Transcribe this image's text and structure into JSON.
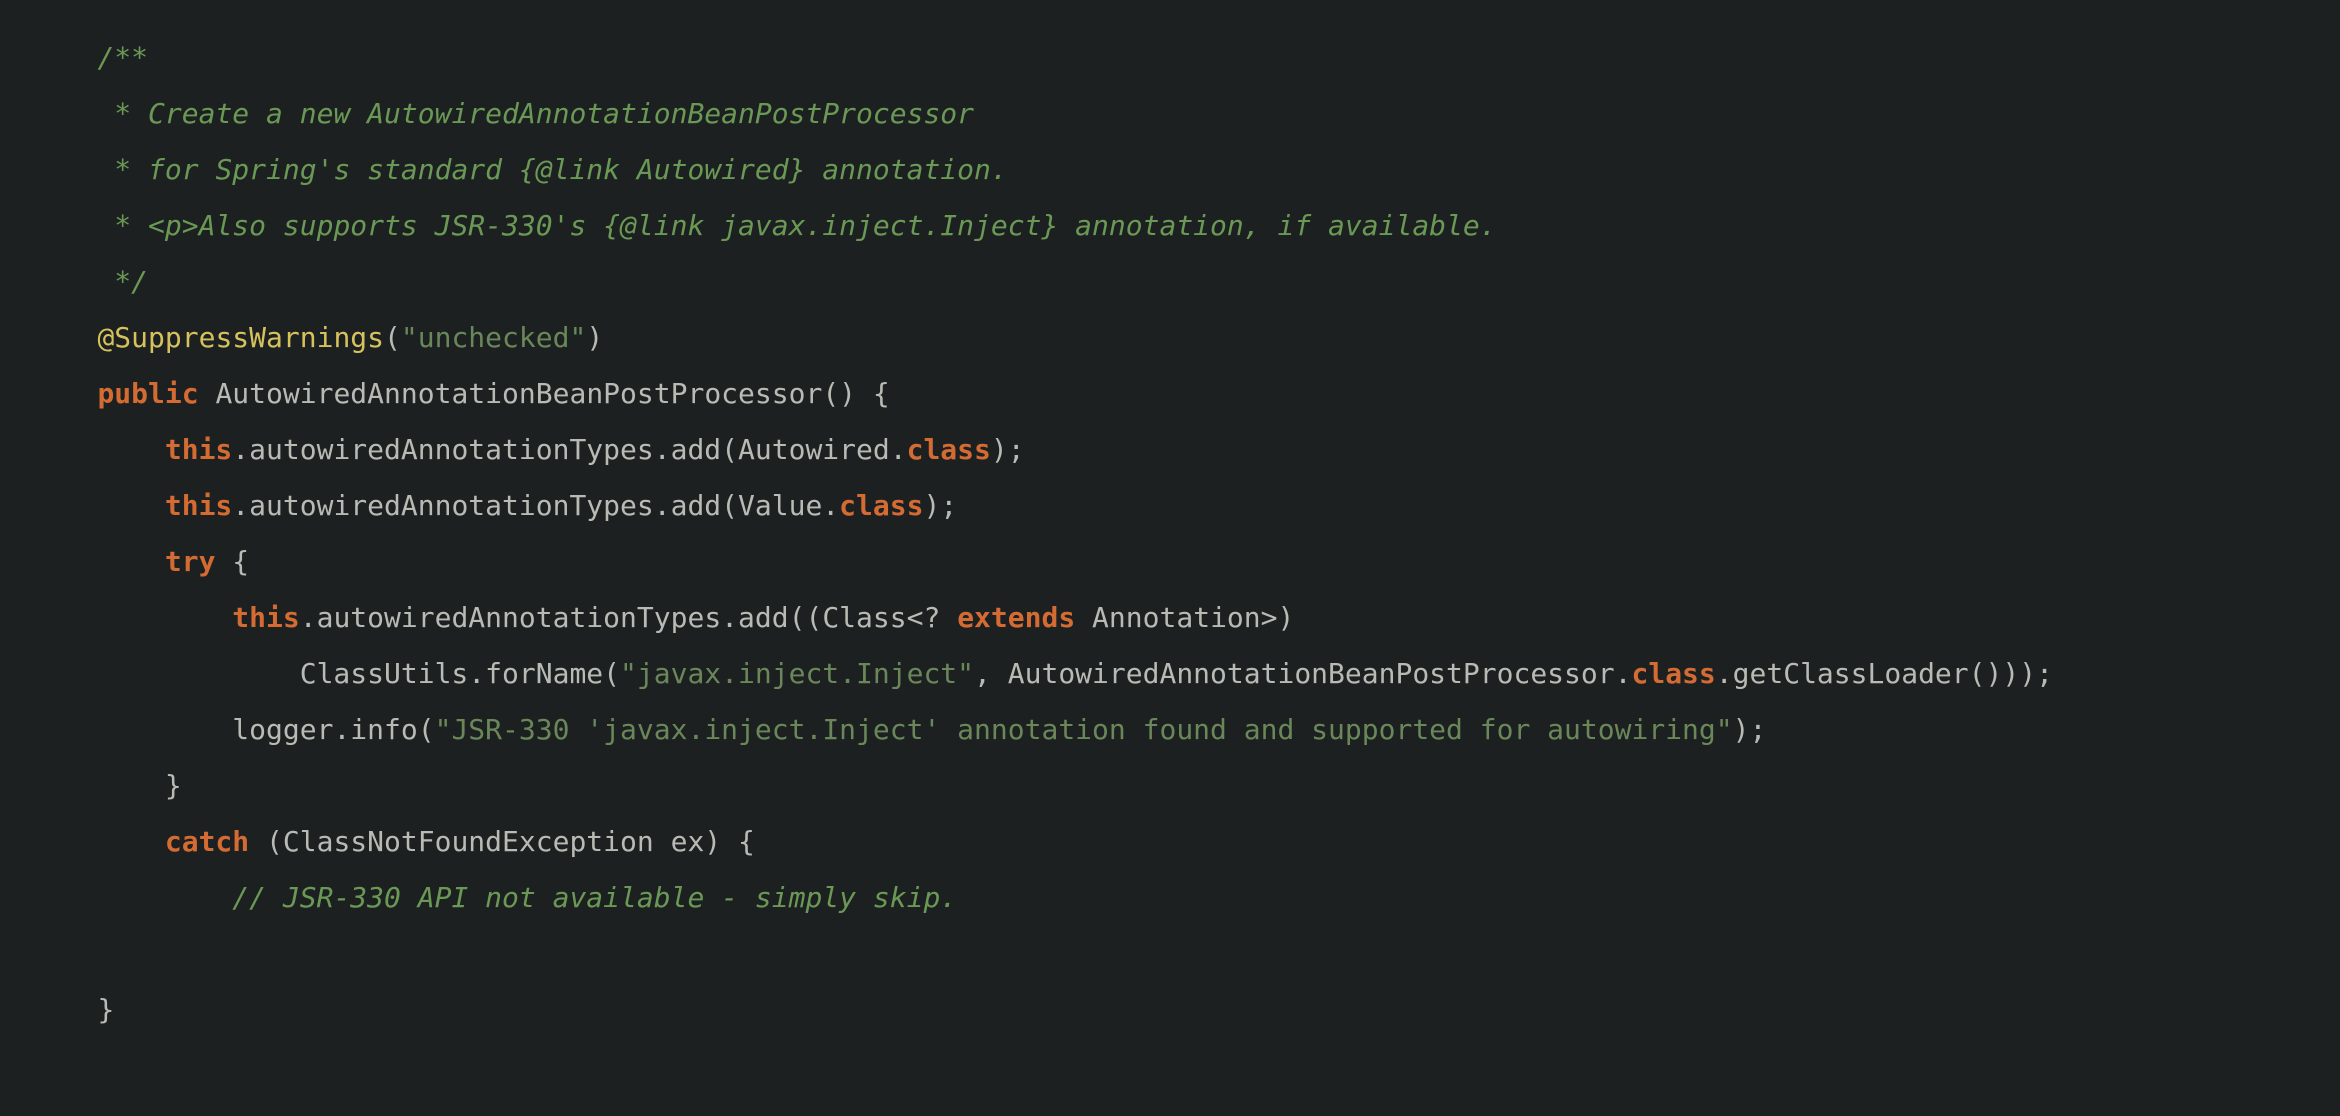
{
  "code": {
    "tokens": {
      "c1_a": "/**",
      "c2_a": " * Create a new AutowiredAnnotationBeanPostProcessor",
      "c3_a": " * for Spring's standard {@link Autowired} annotation.",
      "c4_a": " * <p>Also supports JSR-330's {@link javax.inject.Inject} annotation, if available.",
      "c5_a": " */",
      "l6_a": "@SuppressWarnings",
      "l6_b": "(",
      "l6_c": "\"unchecked\"",
      "l6_d": ")",
      "l7_a": "public",
      "l7_b": " AutowiredAnnotationBeanPostProcessor() {",
      "l8_a": "this",
      "l8_b": ".autowiredAnnotationTypes.add(Autowired.",
      "l8_c": "class",
      "l8_d": ");",
      "l9_a": "this",
      "l9_b": ".autowiredAnnotationTypes.add(Value.",
      "l9_c": "class",
      "l9_d": ");",
      "l10_a": "try",
      "l10_b": " {",
      "l11_a": "this",
      "l11_b": ".autowiredAnnotationTypes.add((Class<? ",
      "l11_c": "extends",
      "l11_d": " Annotation>)",
      "l12_a": "ClassUtils.forName(",
      "l12_b": "\"javax.inject.Inject\"",
      "l12_c": ", AutowiredAnnotationBeanPostProcessor.",
      "l12_d": "class",
      "l12_e": ".getClassLoader()));",
      "l13_a": "logger.info(",
      "l13_b": "\"JSR-330 'javax.inject.Inject' annotation found and supported for autowiring\"",
      "l13_c": ");",
      "l14_a": "}",
      "l15_a": "catch",
      "l15_b": " (ClassNotFoundException ex) {",
      "l16_a": "// JSR-330 API not available - simply skip.",
      "l18_a": "}"
    },
    "indent": {
      "i1": "    ",
      "i2": "        ",
      "i3": "            ",
      "i4": "                "
    }
  }
}
